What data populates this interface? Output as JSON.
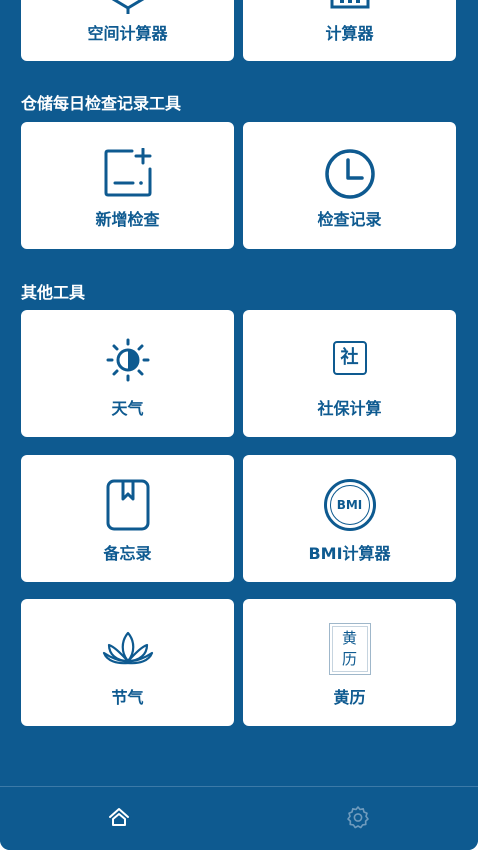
{
  "top_cards": {
    "space_calculator": "空间计算器",
    "calculator": "计算器"
  },
  "warehouse_section": {
    "title": "仓储每日检查记录工具",
    "new_check": "新增检查",
    "check_records": "检查记录"
  },
  "other_section": {
    "title": "其他工具",
    "weather": "天气",
    "social_security": "社保计算",
    "social_security_icon_char": "社",
    "memo": "备忘录",
    "bmi_calculator": "BMI计算器",
    "bmi_icon_text": "BMI",
    "solar_terms": "节气",
    "almanac": "黄历",
    "almanac_icon_top": "黄",
    "almanac_icon_bottom": "历"
  },
  "bottom_nav": {
    "home_icon": "home-icon",
    "settings_icon": "gear-icon"
  },
  "colors": {
    "primary": "#0e5a90",
    "card": "#ffffff",
    "inactive_icon": "#6f9bbd"
  }
}
